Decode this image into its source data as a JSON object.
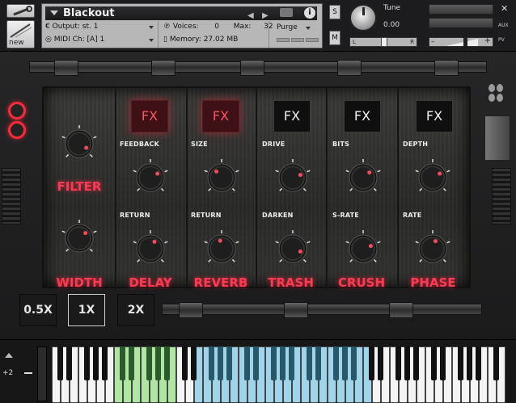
{
  "header": {
    "instrument_name": "Blackout",
    "new_label": "new",
    "output_label": "Output:",
    "output_value": "st. 1",
    "midi_label": "MIDI Ch:",
    "midi_value": "[A]  1",
    "voices_label": "Voices:",
    "voices_value": "0",
    "max_label": "Max:",
    "max_value": "32",
    "memory_label": "Memory:",
    "memory_value": "27.02 MB",
    "purge_label": "Purge",
    "solo_label": "S",
    "mute_label": "M",
    "tune_label": "Tune",
    "tune_value": "0.00",
    "pan_left": "L",
    "pan_right": "R",
    "aux_label": "AUX",
    "pv_label": "PV"
  },
  "panel": {
    "modules": [
      {
        "name": "FILTER",
        "knob_labels": [],
        "fx_active": false
      },
      {
        "name": "DELAY",
        "knob_labels": [
          "FEEDBACK",
          "RETURN"
        ],
        "fx_active": true,
        "fx_label": "FX"
      },
      {
        "name": "REVERB",
        "knob_labels": [
          "SIZE",
          "RETURN"
        ],
        "fx_active": true,
        "fx_label": "FX"
      },
      {
        "name": "TRASH",
        "knob_labels": [
          "DRIVE",
          "DARKEN"
        ],
        "fx_active": false,
        "fx_label": "FX"
      },
      {
        "name": "CRUSH",
        "knob_labels": [
          "BITS",
          "S-RATE"
        ],
        "fx_active": false,
        "fx_label": "FX"
      },
      {
        "name": "PHASE",
        "knob_labels": [
          "DEPTH",
          "RATE"
        ],
        "fx_active": false,
        "fx_label": "FX"
      }
    ],
    "width_label": "WIDTH",
    "speed_buttons": [
      "0.5X",
      "1X",
      "2X"
    ],
    "selected_speed": "1X"
  },
  "keyboard": {
    "octave_value": "+2"
  },
  "colors": {
    "accent_red": "#ff3b52",
    "key_green": "#aee6a2",
    "key_blue": "#9fd4ea"
  }
}
